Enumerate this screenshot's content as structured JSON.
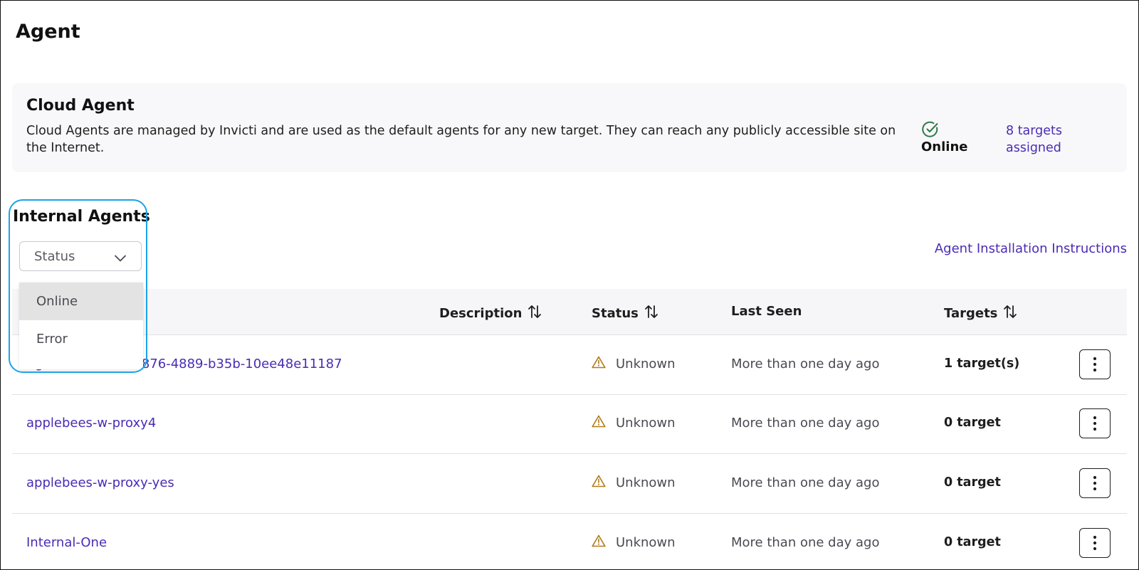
{
  "page": {
    "title": "Agent"
  },
  "cloud_agent": {
    "title": "Cloud Agent",
    "description": "Cloud Agents are managed by Invicti and are used as the default agents for any new target. They can reach any publicly accessible site on the Internet.",
    "status": "Online",
    "status_icon": "check-circle-icon",
    "targets_link": "8 targets assigned"
  },
  "internal_agents": {
    "title": "Internal Agents",
    "install_link": "Agent Installation Instructions",
    "status_filter": {
      "label": "Status",
      "options": [
        "Online",
        "Error"
      ],
      "highlighted_option": "Online"
    }
  },
  "table": {
    "columns": {
      "description": "Description",
      "status": "Status",
      "last_seen": "Last Seen",
      "targets": "Targets"
    },
    "rows": [
      {
        "name": "Agent 062f0bcb-5876-4889-b35b-10ee48e11187",
        "status": "Unknown",
        "last_seen": "More than one day ago",
        "targets": "1 target(s)"
      },
      {
        "name": "applebees-w-proxy4",
        "status": "Unknown",
        "last_seen": "More than one day ago",
        "targets": "0 target"
      },
      {
        "name": "applebees-w-proxy-yes",
        "status": "Unknown",
        "last_seen": "More than one day ago",
        "targets": "0 target"
      },
      {
        "name": "Internal-One",
        "status": "Unknown",
        "last_seen": "More than one day ago",
        "targets": "0 target"
      }
    ]
  },
  "colors": {
    "link": "#4a2bb5",
    "online": "#2f7a4a",
    "warning": "#b07a18",
    "highlight": "#1aa3e8"
  }
}
